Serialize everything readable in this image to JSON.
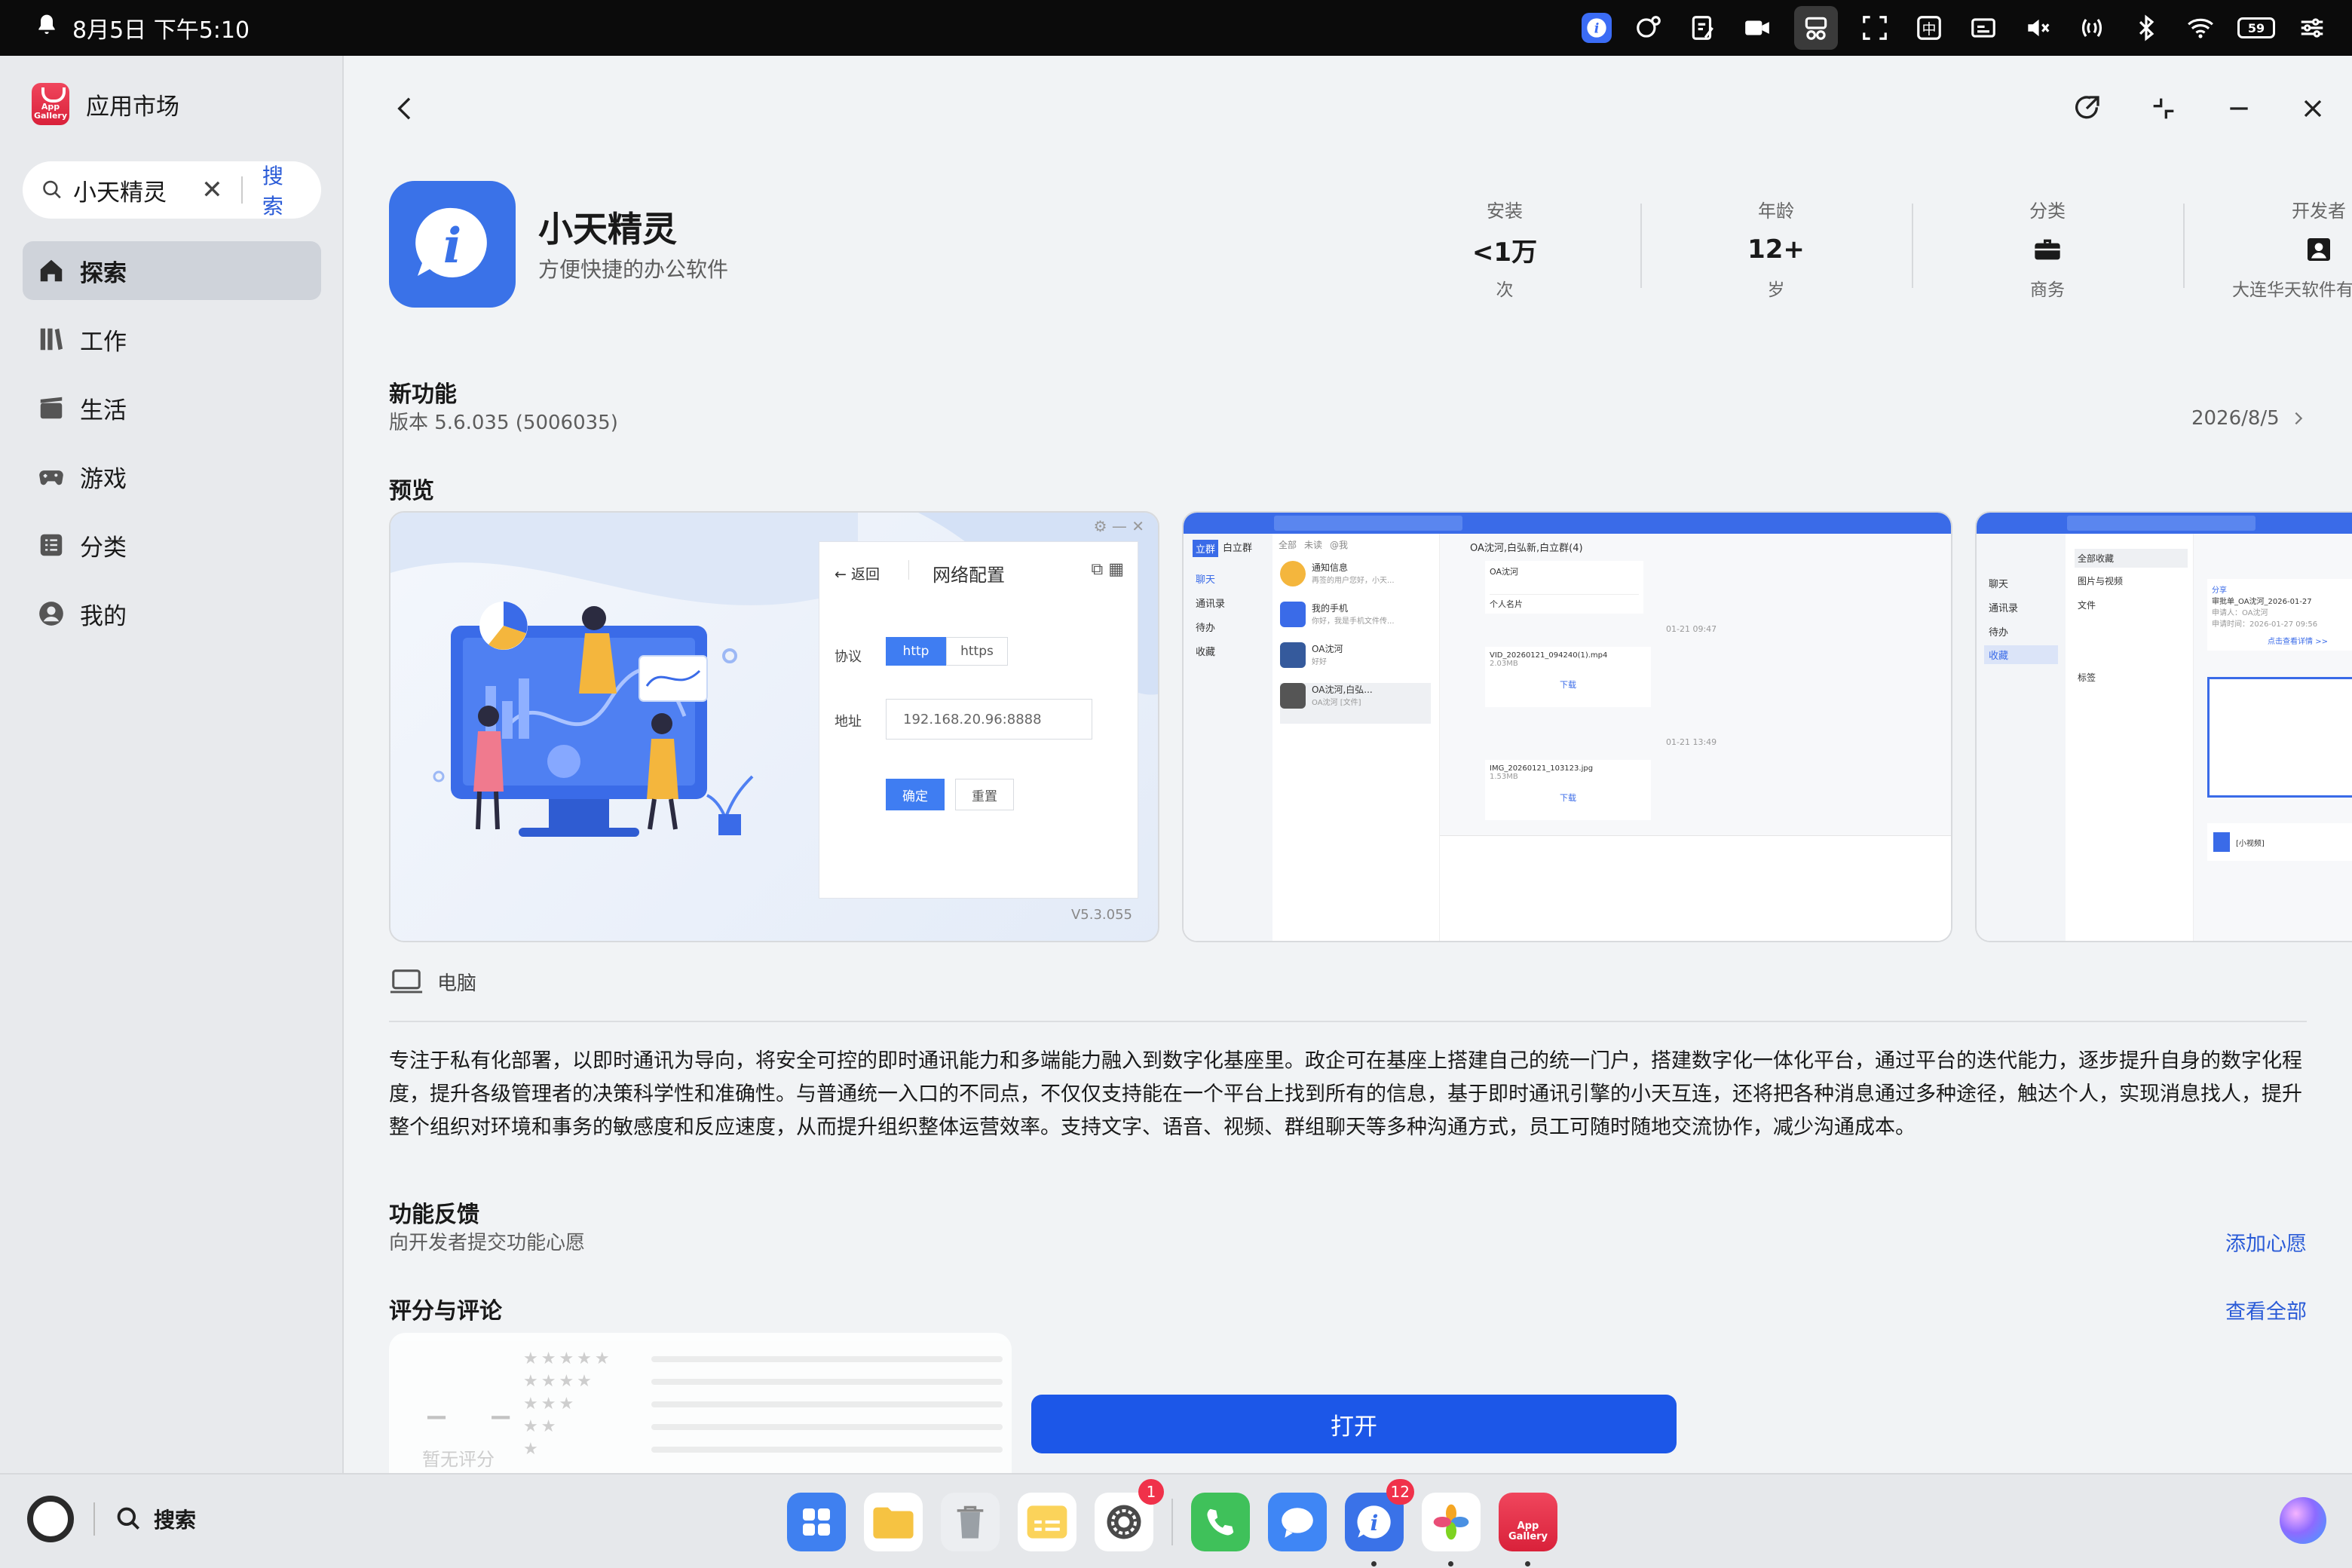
{
  "status_bar": {
    "time": "8月5日 下午5:10",
    "battery": "59",
    "icons": [
      "bell-icon",
      "app-i-icon",
      "face-gear-icon",
      "edit-icon",
      "video-icon",
      "cut-icon",
      "screenshot-icon",
      "ime-icon",
      "subtitle-icon",
      "mute-icon",
      "nfc-icon",
      "bluetooth-icon",
      "wifi-icon",
      "battery-icon",
      "controls-icon"
    ],
    "ime_label": "中"
  },
  "sidebar": {
    "app_title": "应用市场",
    "logo_text_1": "App",
    "logo_text_2": "Gallery",
    "search": {
      "value": "小天精灵",
      "button": "搜索"
    },
    "items": [
      {
        "label": "探索",
        "icon": "home-icon",
        "active": true
      },
      {
        "label": "工作",
        "icon": "books-icon",
        "active": false
      },
      {
        "label": "生活",
        "icon": "clapper-icon",
        "active": false
      },
      {
        "label": "游戏",
        "icon": "gamepad-icon",
        "active": false
      },
      {
        "label": "分类",
        "icon": "list-icon",
        "active": false
      },
      {
        "label": "我的",
        "icon": "user-icon",
        "active": false
      }
    ]
  },
  "app": {
    "name": "小天精灵",
    "subtitle": "方便快捷的办公软件",
    "icon_letter": "i",
    "stats": [
      {
        "label": "安装",
        "value": "<1万",
        "unit": "次"
      },
      {
        "label": "年龄",
        "value": "12+",
        "unit": "岁"
      },
      {
        "label": "分类",
        "value_icon": "briefcase-icon",
        "unit": "商务"
      },
      {
        "label": "开发者",
        "value_icon": "developer-icon",
        "unit": "大连华天软件有限公司"
      }
    ]
  },
  "whats_new": {
    "title": "新功能",
    "version": "版本 5.6.035 (5006035)",
    "date": "2026/8/5"
  },
  "preview": {
    "title": "预览",
    "shot1": {
      "back": "返回",
      "title": "网络配置",
      "protocol_label": "协议",
      "opt_http": "http",
      "opt_https": "https",
      "address_label": "地址",
      "address_value": "192.168.20.96:8888",
      "confirm": "确定",
      "reset": "重置",
      "version": "V5.3.055"
    },
    "shot2": {
      "tabs": [
        "立群",
        "白立群"
      ],
      "side": [
        "聊天",
        "通讯录",
        "待办",
        "收藏"
      ],
      "filters": [
        "全部",
        "未读",
        "@我"
      ],
      "chats": [
        {
          "name": "通知信息",
          "preview": "再签的用户您好，小天..."
        },
        {
          "name": "我的手机",
          "preview": "你好，我是手机文件传..."
        },
        {
          "name": "OA沈河",
          "preview": "好好"
        },
        {
          "name": "OA沈河,白弘...",
          "preview": "OA沈河 [文件]"
        }
      ],
      "header": "OA沈河,白弘新,白立群(4)",
      "msg_sender": "OA沈河",
      "card": "个人名片",
      "ts1": "01-21 09:47",
      "file1": "VID_20260121_094240(1).mp4",
      "size1": "2.03MB",
      "ts2": "01-21 13:49",
      "file2": "IMG_20260121_103123.jpg",
      "size2": "1.53MB",
      "download": "下载"
    },
    "shot3": {
      "side": [
        "聊天",
        "通讯录",
        "待办",
        "收藏"
      ],
      "menu": [
        "全部收藏",
        "图片与视频",
        "文件"
      ],
      "tag": "标签",
      "card_title": "分享",
      "card_line1": "审批单_OA沈河_2026-01-27",
      "card_line2": "申请人：OA沈河",
      "card_line3": "申请时间：2026-01-27 09:56",
      "card_link": "点击查看详情 >>",
      "video": "[小视频]"
    },
    "device": "电脑"
  },
  "description": "专注于私有化部署，以即时通讯为导向，将安全可控的即时通讯能力和多端能力融入到数字化基座里。政企可在基座上搭建自己的统一门户，搭建数字化一体化平台，通过平台的迭代能力，逐步提升自身的数字化程度，提升各级管理者的决策科学性和准确性。与普通统一入口的不同点，不仅仅支持能在一个平台上找到所有的信息，基于即时通讯引擎的小天互连，还将把各种消息通过多种途径，触达个人，实现消息找人，提升整个组织对环境和事务的敏感度和反应速度，从而提升组织整体运营效率。支持文字、语音、视频、群组聊天等多种沟通方式，员工可随时随地交流协作，减少沟通成本。",
  "feedback": {
    "title": "功能反馈",
    "sub": "向开发者提交功能心愿",
    "action": "添加心愿"
  },
  "reviews": {
    "title": "评分与评论",
    "action": "查看全部",
    "score": "– –",
    "none": "暂无评分"
  },
  "open_button": "打开",
  "dock": {
    "search": "搜索",
    "apps": [
      {
        "name": "apps-grid-icon",
        "badge": ""
      },
      {
        "name": "files-icon",
        "badge": ""
      },
      {
        "name": "trash-icon",
        "badge": ""
      },
      {
        "name": "notes-icon",
        "badge": ""
      },
      {
        "name": "settings-icon",
        "badge": "1"
      },
      {
        "name": "phone-icon",
        "badge": ""
      },
      {
        "name": "messages-icon",
        "badge": ""
      },
      {
        "name": "xiaotian-icon",
        "badge": "12"
      },
      {
        "name": "photos-icon",
        "badge": ""
      },
      {
        "name": "appgallery-icon",
        "badge": ""
      }
    ]
  },
  "colors": {
    "accent": "#1c57e8",
    "link": "#2a5bd7",
    "app_icon": "#3a72e8",
    "badge": "#f0314a"
  }
}
